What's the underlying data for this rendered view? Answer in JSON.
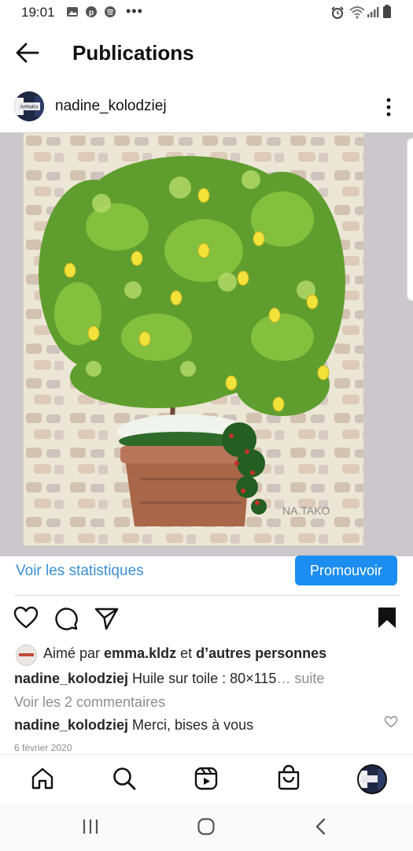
{
  "status_bar": {
    "time": "19:01",
    "dots": "•••"
  },
  "header": {
    "title": "Publications"
  },
  "post": {
    "username": "nadine_kolodziej",
    "avatar_text": "ArtNaKo",
    "painting_signature": "NA.TAKO",
    "stats_link": "Voir les statistiques",
    "promote_button": "Promouvoir",
    "likes": {
      "prefix": "Aimé par",
      "user": "emma.kldz",
      "middle": "et",
      "others": "d’autres personnes"
    },
    "caption": {
      "user": "nadine_kolodziej",
      "text": "Huile sur toile : 80×115",
      "more": "… suite"
    },
    "view_comments": "Voir les 2 commentaires",
    "comment": {
      "user": "nadine_kolodziej",
      "text": "Merci, bises à vous"
    },
    "date": "6 février 2020"
  },
  "tabs": [
    "home",
    "search",
    "reels",
    "shop",
    "profile"
  ],
  "colors": {
    "accent": "#1d8ef1",
    "link": "#3a8fd6",
    "muted": "#8e8e8e"
  }
}
